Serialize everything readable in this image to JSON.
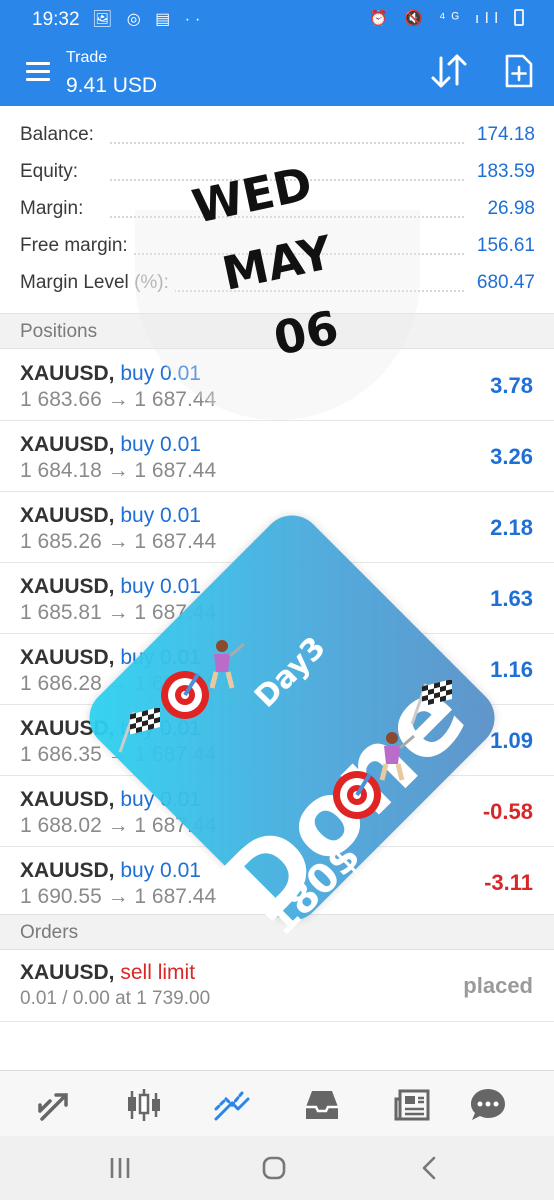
{
  "status_bar": {
    "time": "19:32",
    "icons_left": "🖼 ◎ ▤ ··",
    "icons_right": "⏰ 🔇 ⁴ᴳ ıll"
  },
  "app_bar": {
    "title": "Trade",
    "subtitle": "9.41 USD"
  },
  "summary": [
    {
      "label": "Balance:",
      "value": "174.18"
    },
    {
      "label": "Equity:",
      "value": "183.59"
    },
    {
      "label": "Margin:",
      "value": "26.98"
    },
    {
      "label": "Free margin:",
      "value": "156.61"
    },
    {
      "label": "Margin Level",
      "label_muted": "(%):",
      "value": "680.47"
    }
  ],
  "sections": {
    "positions": "Positions",
    "orders": "Orders"
  },
  "positions": [
    {
      "symbol": "XAUUSD,",
      "type": "buy 0.01",
      "prices": "1 683.66 → 1 687.44",
      "profit": "3.78",
      "sign": "pos"
    },
    {
      "symbol": "XAUUSD,",
      "type": "buy 0.01",
      "prices": "1 684.18 → 1 687.44",
      "profit": "3.26",
      "sign": "pos"
    },
    {
      "symbol": "XAUUSD,",
      "type": "buy 0.01",
      "prices": "1 685.26 → 1 687.44",
      "profit": "2.18",
      "sign": "pos"
    },
    {
      "symbol": "XAUUSD,",
      "type": "buy 0.01",
      "prices": "1 685.81 → 1 687.44",
      "profit": "1.63",
      "sign": "pos"
    },
    {
      "symbol": "XAUUSD,",
      "type": "buy 0.01",
      "prices": "1 686.28 → 1 687.44",
      "profit": "1.16",
      "sign": "pos"
    },
    {
      "symbol": "XAUUSD,",
      "type": "buy 0.01",
      "prices": "1 686.35 → 1 687.44",
      "profit": "1.09",
      "sign": "pos"
    },
    {
      "symbol": "XAUUSD,",
      "type": "buy 0.01",
      "prices": "1 688.02 → 1 687.44",
      "profit": "-0.58",
      "sign": "neg"
    },
    {
      "symbol": "XAUUSD,",
      "type": "buy 0.01",
      "prices": "1 690.55 → 1 687.44",
      "profit": "-3.11",
      "sign": "neg"
    }
  ],
  "order": {
    "symbol": "XAUUSD,",
    "type": "sell limit",
    "detail": "0.01 / 0.00 at 1 739.00",
    "status": "placed"
  },
  "overlay": {
    "line1": "WED",
    "line2": "MAY",
    "line3": "06"
  },
  "sticker": {
    "day": "Day3",
    "done": "Done",
    "amount": "180$"
  },
  "colors": {
    "accent": "#2a86e8",
    "positive": "#1e6fd6",
    "negative": "#d62828"
  }
}
